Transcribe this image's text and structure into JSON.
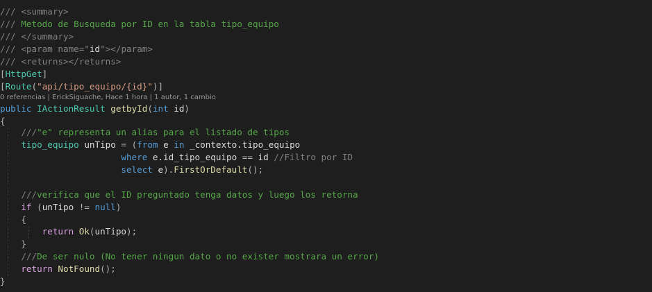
{
  "code_lines": [
    [
      {
        "t": "/// ",
        "c": "c-gray"
      },
      {
        "t": "<summary>",
        "c": "c-gray"
      }
    ],
    [
      {
        "t": "/// ",
        "c": "c-gray"
      },
      {
        "t": "Metodo de Busqueda por ID en la tabla tipo_equipo",
        "c": "c-comment"
      }
    ],
    [
      {
        "t": "/// ",
        "c": "c-gray"
      },
      {
        "t": "</summary>",
        "c": "c-gray"
      }
    ],
    [
      {
        "t": "/// ",
        "c": "c-gray"
      },
      {
        "t": "<param name=",
        "c": "c-gray"
      },
      {
        "t": "\"",
        "c": "c-gray"
      },
      {
        "t": "id",
        "c": "c-text"
      },
      {
        "t": "\"",
        "c": "c-gray"
      },
      {
        "t": "></param>",
        "c": "c-gray"
      }
    ],
    [
      {
        "t": "/// ",
        "c": "c-gray"
      },
      {
        "t": "<returns></returns>",
        "c": "c-gray"
      }
    ],
    [
      {
        "t": "[",
        "c": "c-punct"
      },
      {
        "t": "HttpGet",
        "c": "c-attr"
      },
      {
        "t": "]",
        "c": "c-punct"
      }
    ],
    [
      {
        "t": "[",
        "c": "c-punct"
      },
      {
        "t": "Route",
        "c": "c-attr"
      },
      {
        "t": "(",
        "c": "c-punct"
      },
      {
        "t": "\"api/tipo_equipo/{id}\"",
        "c": "c-string"
      },
      {
        "t": ")]",
        "c": "c-punct"
      }
    ],
    [
      {
        "t": "public ",
        "c": "c-keyword"
      },
      {
        "t": "IActionResult ",
        "c": "c-type"
      },
      {
        "t": "getbyId",
        "c": "c-method"
      },
      {
        "t": "(",
        "c": "c-punct"
      },
      {
        "t": "int ",
        "c": "c-keyword"
      },
      {
        "t": "id",
        "c": "c-text"
      },
      {
        "t": ")",
        "c": "c-punct"
      }
    ],
    [
      {
        "t": "{",
        "c": "c-punct"
      }
    ],
    [
      {
        "t": "    ///",
        "c": "c-gray"
      },
      {
        "t": "\"e\" representa un alias para el listado de tipos",
        "c": "c-comment"
      }
    ],
    [
      {
        "t": "    ",
        "c": "c-text"
      },
      {
        "t": "tipo_equipo ",
        "c": "c-type"
      },
      {
        "t": "unTipo ",
        "c": "c-text"
      },
      {
        "t": "= (",
        "c": "c-punct"
      },
      {
        "t": "from ",
        "c": "c-keyword"
      },
      {
        "t": "e ",
        "c": "c-text"
      },
      {
        "t": "in ",
        "c": "c-keyword"
      },
      {
        "t": "_contexto.tipo_equipo",
        "c": "c-text"
      }
    ],
    [
      {
        "t": "                       ",
        "c": "c-text"
      },
      {
        "t": "where ",
        "c": "c-keyword"
      },
      {
        "t": "e.id_tipo_equipo ",
        "c": "c-text"
      },
      {
        "t": "== ",
        "c": "c-punct"
      },
      {
        "t": "id ",
        "c": "c-text"
      },
      {
        "t": "//Filtro por ID",
        "c": "c-gray"
      }
    ],
    [
      {
        "t": "                       ",
        "c": "c-text"
      },
      {
        "t": "select ",
        "c": "c-keyword"
      },
      {
        "t": "e",
        "c": "c-text"
      },
      {
        "t": ").",
        "c": "c-punct"
      },
      {
        "t": "FirstOrDefault",
        "c": "c-method"
      },
      {
        "t": "();",
        "c": "c-punct"
      }
    ],
    [],
    [
      {
        "t": "    ///",
        "c": "c-gray"
      },
      {
        "t": "verifica que el ID preguntado tenga datos y luego los retorna",
        "c": "c-comment"
      }
    ],
    [
      {
        "t": "    ",
        "c": "c-text"
      },
      {
        "t": "if ",
        "c": "c-ctrl"
      },
      {
        "t": "(",
        "c": "c-punct"
      },
      {
        "t": "unTipo ",
        "c": "c-text"
      },
      {
        "t": "!= ",
        "c": "c-punct"
      },
      {
        "t": "null",
        "c": "c-keyword"
      },
      {
        "t": ")",
        "c": "c-punct"
      }
    ],
    [
      {
        "t": "    {",
        "c": "c-punct"
      }
    ],
    [
      {
        "t": "        ",
        "c": "c-text"
      },
      {
        "t": "return ",
        "c": "c-ctrl"
      },
      {
        "t": "Ok",
        "c": "c-method"
      },
      {
        "t": "(",
        "c": "c-punct"
      },
      {
        "t": "unTipo",
        "c": "c-text"
      },
      {
        "t": ");",
        "c": "c-punct"
      }
    ],
    [
      {
        "t": "    }",
        "c": "c-punct"
      }
    ],
    [
      {
        "t": "    ///",
        "c": "c-gray"
      },
      {
        "t": "De ser nulo (No tener ningun dato o no exister mostrara un error)",
        "c": "c-comment"
      }
    ],
    [
      {
        "t": "    ",
        "c": "c-text"
      },
      {
        "t": "return ",
        "c": "c-ctrl"
      },
      {
        "t": "NotFound",
        "c": "c-method"
      },
      {
        "t": "();",
        "c": "c-punct"
      }
    ],
    [
      {
        "t": "}",
        "c": "c-punct"
      }
    ]
  ],
  "codelens": {
    "references": "0 referencias",
    "sep1": " | ",
    "author": "ErickSiguache, Hace 1 hora",
    "sep2": " | ",
    "changes": "1 autor, 1 cambio"
  }
}
